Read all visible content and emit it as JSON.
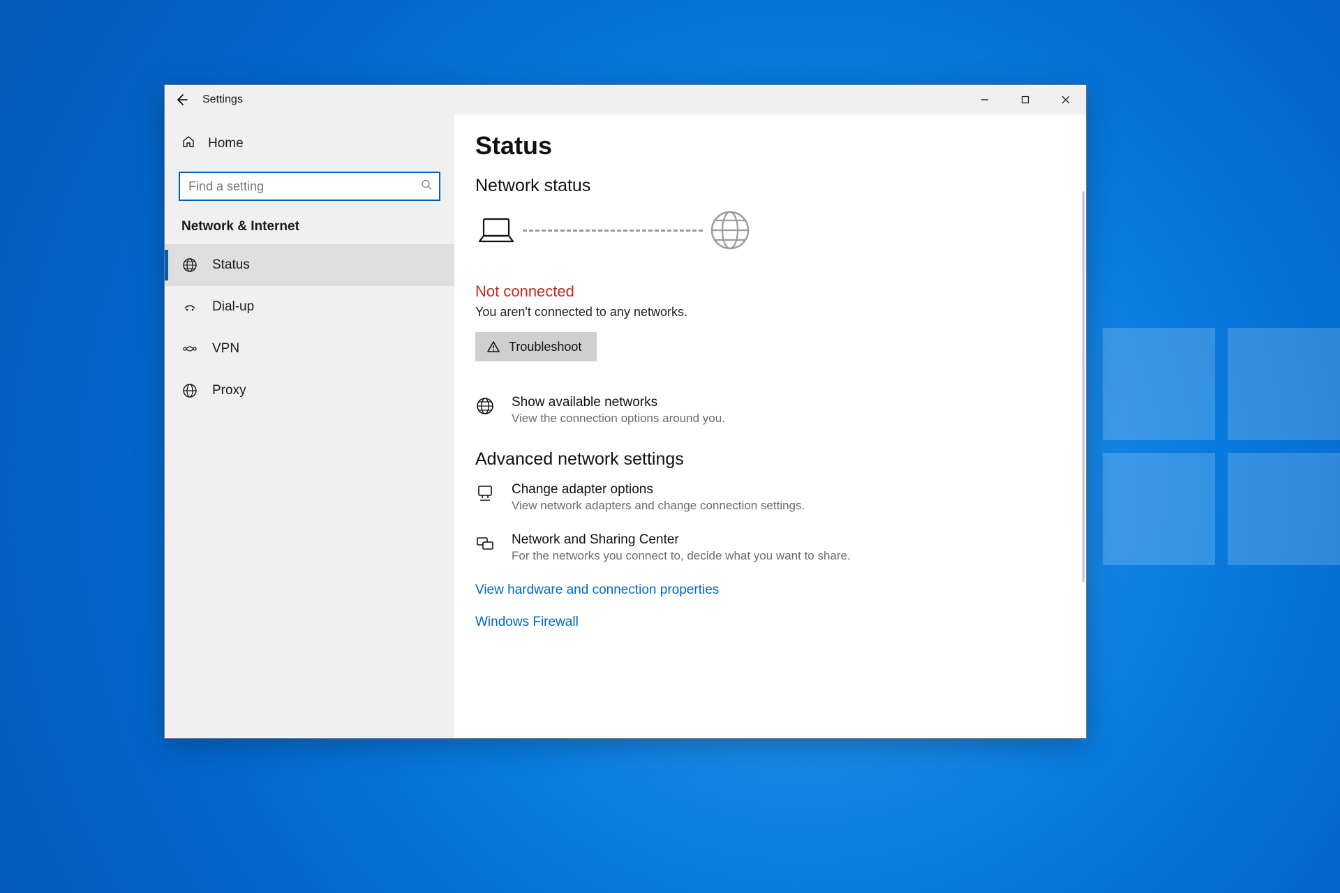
{
  "window": {
    "title": "Settings"
  },
  "sidebar": {
    "home": "Home",
    "search_placeholder": "Find a setting",
    "category": "Network & Internet",
    "items": [
      {
        "label": "Status",
        "active": true
      },
      {
        "label": "Dial-up",
        "active": false
      },
      {
        "label": "VPN",
        "active": false
      },
      {
        "label": "Proxy",
        "active": false
      }
    ]
  },
  "content": {
    "title": "Status",
    "network_status_heading": "Network status",
    "status_flag": "Not connected",
    "status_flag_color": "#c42b1c",
    "status_sub": "You aren't connected to any networks.",
    "troubleshoot": "Troubleshoot",
    "show_networks": {
      "title": "Show available networks",
      "desc": "View the connection options around you."
    },
    "advanced_heading": "Advanced network settings",
    "adapter": {
      "title": "Change adapter options",
      "desc": "View network adapters and change connection settings."
    },
    "sharing": {
      "title": "Network and Sharing Center",
      "desc": "For the networks you connect to, decide what you want to share."
    },
    "link_hardware": "View hardware and connection properties",
    "link_firewall": "Windows Firewall"
  }
}
